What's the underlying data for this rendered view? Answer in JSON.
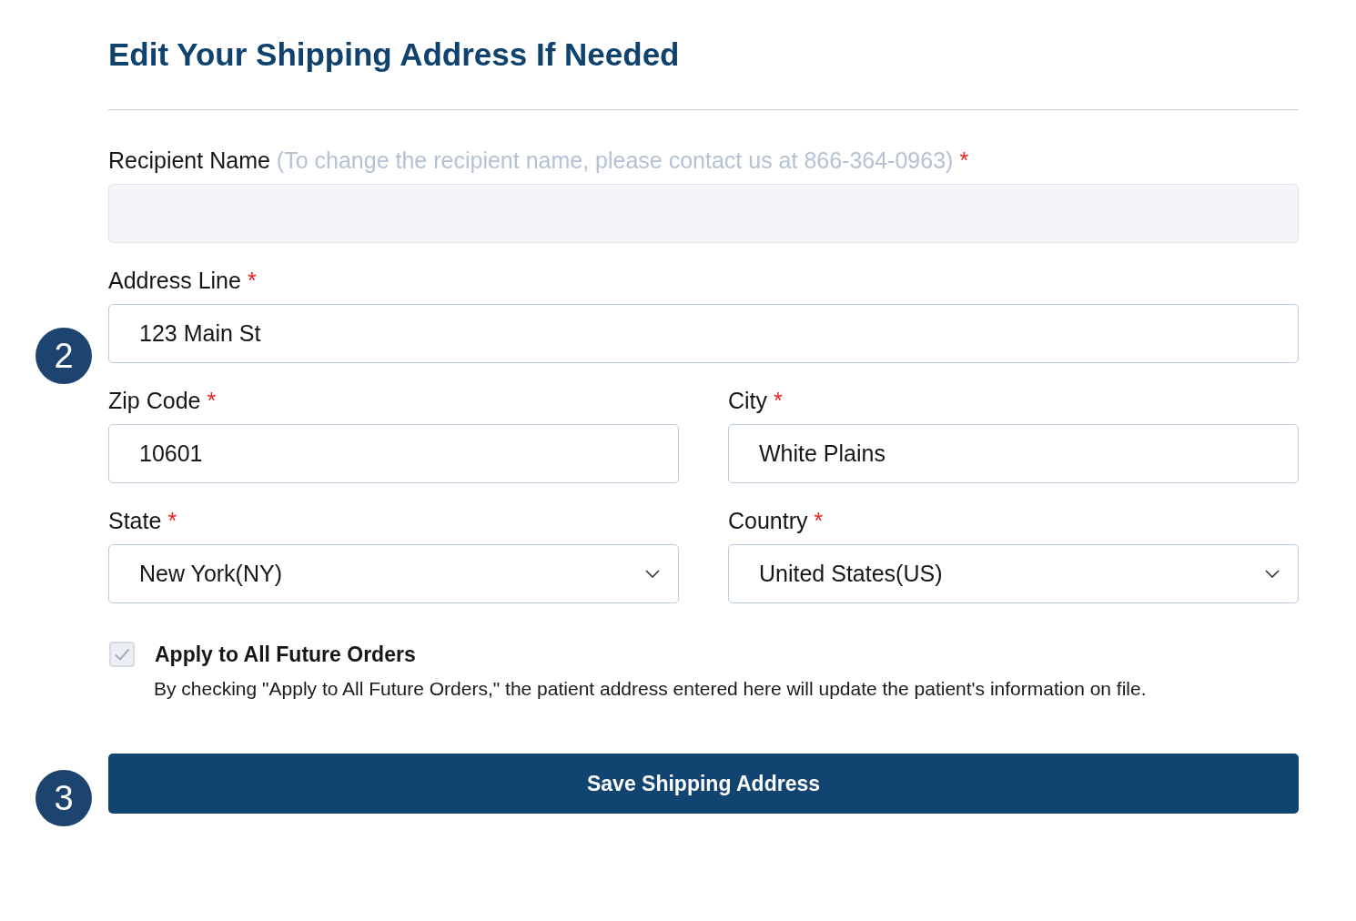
{
  "title": "Edit Your Shipping Address If Needed",
  "rows": [
    {
      "fields": [
        {
          "kind": "text",
          "label": "Recipient Name",
          "hint": "(To change the recipient name, please contact us at 866-364-0963)",
          "required_mark": "*",
          "disabled": true
        }
      ]
    },
    {
      "step_marker": "2",
      "fields": [
        {
          "kind": "text",
          "label": "Address Line",
          "required_mark": "*",
          "value": "123 Main St",
          "disabled": false
        }
      ]
    },
    {
      "fields": [
        {
          "kind": "text",
          "label": "Zip Code",
          "required_mark": "*",
          "value": "10601",
          "disabled": false
        },
        {
          "kind": "text",
          "label": "City",
          "required_mark": "*",
          "value": "White Plains",
          "disabled": false
        }
      ]
    },
    {
      "fields": [
        {
          "kind": "select",
          "label": "State",
          "required_mark": "*",
          "value": "New York(NY)",
          "disabled": false
        },
        {
          "kind": "select",
          "label": "Country",
          "required_mark": "*",
          "value": "United States(US)",
          "disabled": false
        }
      ]
    }
  ],
  "apply_to_future_orders": {
    "label": "Apply to All Future Orders",
    "description": "By checking \"Apply to All Future Orders,\" the patient address entered here will update the patient's information on file.",
    "checked": true,
    "disabled": true
  },
  "save_button": {
    "label": "Save Shipping Address",
    "step_marker": "3"
  }
}
